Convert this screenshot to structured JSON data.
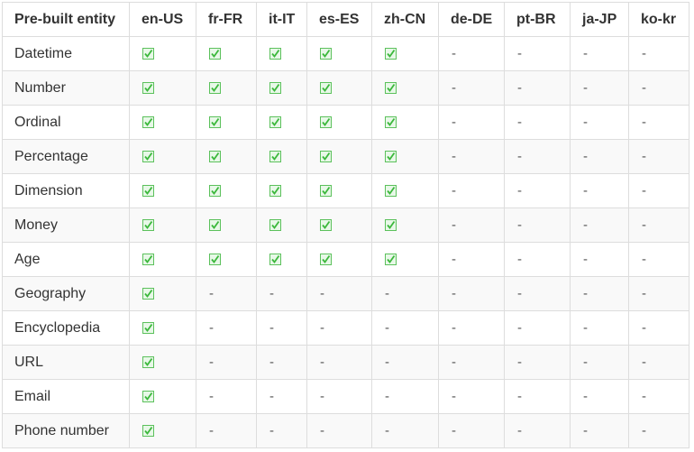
{
  "table": {
    "headers": [
      "Pre-built entity",
      "en-US",
      "fr-FR",
      "it-IT",
      "es-ES",
      "zh-CN",
      "de-DE",
      "pt-BR",
      "ja-JP",
      "ko-kr"
    ],
    "rows": [
      {
        "entity": "Datetime",
        "support": [
          true,
          true,
          true,
          true,
          true,
          false,
          false,
          false,
          false
        ]
      },
      {
        "entity": "Number",
        "support": [
          true,
          true,
          true,
          true,
          true,
          false,
          false,
          false,
          false
        ]
      },
      {
        "entity": "Ordinal",
        "support": [
          true,
          true,
          true,
          true,
          true,
          false,
          false,
          false,
          false
        ]
      },
      {
        "entity": "Percentage",
        "support": [
          true,
          true,
          true,
          true,
          true,
          false,
          false,
          false,
          false
        ]
      },
      {
        "entity": "Dimension",
        "support": [
          true,
          true,
          true,
          true,
          true,
          false,
          false,
          false,
          false
        ]
      },
      {
        "entity": "Money",
        "support": [
          true,
          true,
          true,
          true,
          true,
          false,
          false,
          false,
          false
        ]
      },
      {
        "entity": "Age",
        "support": [
          true,
          true,
          true,
          true,
          true,
          false,
          false,
          false,
          false
        ]
      },
      {
        "entity": "Geography",
        "support": [
          true,
          false,
          false,
          false,
          false,
          false,
          false,
          false,
          false
        ]
      },
      {
        "entity": "Encyclopedia",
        "support": [
          true,
          false,
          false,
          false,
          false,
          false,
          false,
          false,
          false
        ]
      },
      {
        "entity": "URL",
        "support": [
          true,
          false,
          false,
          false,
          false,
          false,
          false,
          false,
          false
        ]
      },
      {
        "entity": "Email",
        "support": [
          true,
          false,
          false,
          false,
          false,
          false,
          false,
          false,
          false
        ]
      },
      {
        "entity": "Phone number",
        "support": [
          true,
          false,
          false,
          false,
          false,
          false,
          false,
          false,
          false
        ]
      }
    ],
    "supported_icon": "check-box-icon",
    "unsupported_text": "-",
    "check_color": "#3cb83c"
  }
}
